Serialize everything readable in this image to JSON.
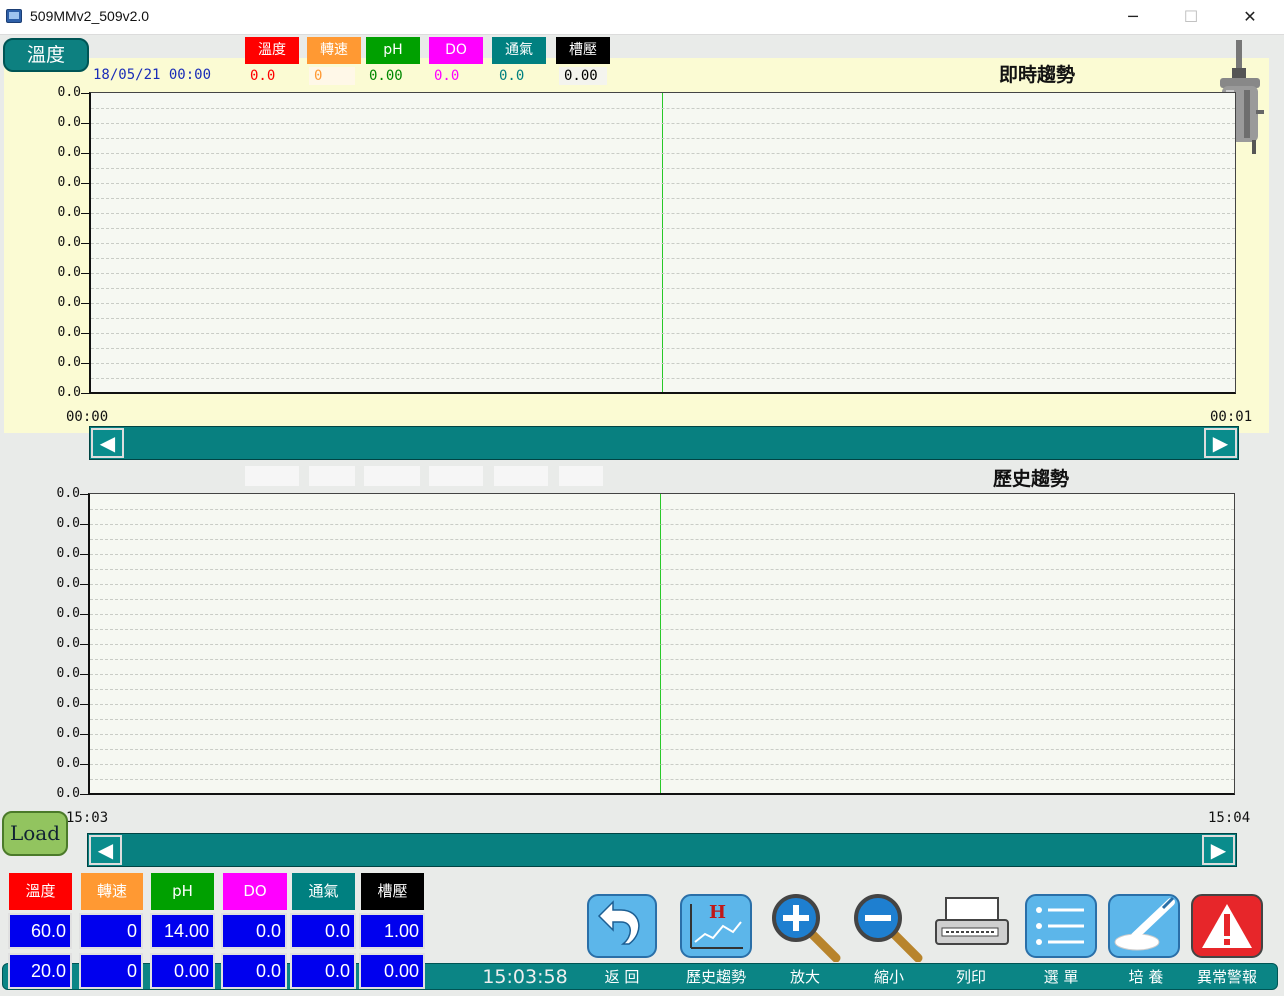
{
  "window": {
    "title": "509MMv2_509v2.0",
    "minimize": "─",
    "maximize": "☐",
    "close": "✕"
  },
  "selector": {
    "label": "溫度"
  },
  "legend": [
    {
      "label": "溫度",
      "color": "#ff0000",
      "value": "0.0",
      "value_color": "#ff0000"
    },
    {
      "label": "轉速",
      "color": "#ff9933",
      "value": "0",
      "value_color": "#ff9933"
    },
    {
      "label": "pH",
      "color": "#00a000",
      "value": "0.00",
      "value_color": "#008800"
    },
    {
      "label": "DO",
      "color": "#ff00ff",
      "value": "0.0",
      "value_color": "#ff00ff"
    },
    {
      "label": "通氣",
      "color": "#008080",
      "value": "0.0",
      "value_color": "#008080"
    },
    {
      "label": "槽壓",
      "color": "#000000",
      "value": "0.00",
      "value_color": "#000000"
    }
  ],
  "realtime": {
    "date": "18/05/21  00:00",
    "title": "即時趨勢",
    "y_ticks": [
      "0.0",
      "0.0",
      "0.0",
      "0.0",
      "0.0",
      "0.0",
      "0.0",
      "0.0",
      "0.0",
      "0.0",
      "0.0"
    ],
    "x_start": "00:00",
    "x_end": "00:01"
  },
  "history": {
    "title": "歷史趨勢",
    "y_ticks": [
      "0.0",
      "0.0",
      "0.0",
      "0.0",
      "0.0",
      "0.0",
      "0.0",
      "0.0",
      "0.0",
      "0.0",
      "0.0"
    ],
    "x_start": "15:03",
    "x_end": "15:04"
  },
  "scroll": {
    "left": "◀",
    "right": "▶"
  },
  "load": {
    "label": "Load"
  },
  "params": {
    "headers": [
      {
        "label": "溫度",
        "color": "#ff0000"
      },
      {
        "label": "轉速",
        "color": "#ff9933"
      },
      {
        "label": "pH",
        "color": "#00a000"
      },
      {
        "label": "DO",
        "color": "#ff00ff"
      },
      {
        "label": "通氣",
        "color": "#008080"
      },
      {
        "label": "槽壓",
        "color": "#000000"
      }
    ],
    "max_row": [
      "60.0",
      "0",
      "14.00",
      "0.0",
      "0.0",
      "1.00"
    ],
    "min_row": [
      "20.0",
      "0",
      "0.00",
      "0.0",
      "0.0",
      "0.00"
    ]
  },
  "status": {
    "clock": "15:03:58"
  },
  "toolbar": [
    {
      "label": "返 回",
      "icon": "back-arrow-icon"
    },
    {
      "label": "歷史趨勢",
      "icon": "history-chart-icon"
    },
    {
      "label": "放大",
      "icon": "zoom-in-icon"
    },
    {
      "label": "縮小",
      "icon": "zoom-out-icon"
    },
    {
      "label": "列印",
      "icon": "printer-icon"
    },
    {
      "label": "選 單",
      "icon": "menu-list-icon"
    },
    {
      "label": "培 養",
      "icon": "culture-icon"
    },
    {
      "label": "異常警報",
      "icon": "alarm-icon"
    }
  ]
}
